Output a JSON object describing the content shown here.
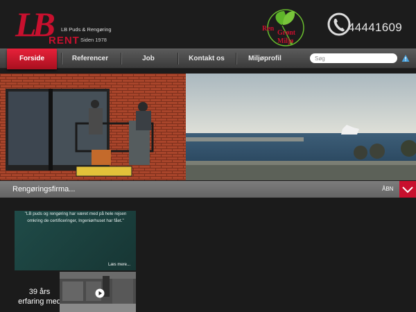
{
  "brand": {
    "logo_letter": "LB",
    "logo_rent": "RENT",
    "tagline": "LB Puds & Rengøring",
    "since": "Siden 1978",
    "eco_line1": "Ren",
    "eco_line2": "Grønt",
    "eco_line3": "Miljø",
    "accent": "#c8102e"
  },
  "phone": {
    "icon": "phone-icon",
    "number": "44441609"
  },
  "nav": {
    "items": [
      {
        "label": "Forside",
        "active": true
      },
      {
        "label": "Referencer"
      },
      {
        "label": "Job"
      },
      {
        "label": "Kontakt os"
      },
      {
        "label": "Miljøprofil"
      }
    ],
    "search_placeholder": "Søg",
    "search_icon": "warning-triangle-icon"
  },
  "hero": {
    "caption": "Rengøringsfirma...",
    "open_label": "ÅBN",
    "toggle_icon": "chevron-down-icon"
  },
  "quote": {
    "text": "\"LB puds og rengøring har været med på hele rejsen omkring de certificeringer, Ingeniørhuset har fået.\"",
    "read_more": "Læs mere..."
  },
  "stat": {
    "line1": "39 års",
    "line2": "erfaring med"
  },
  "video": {
    "icon": "play-icon"
  }
}
